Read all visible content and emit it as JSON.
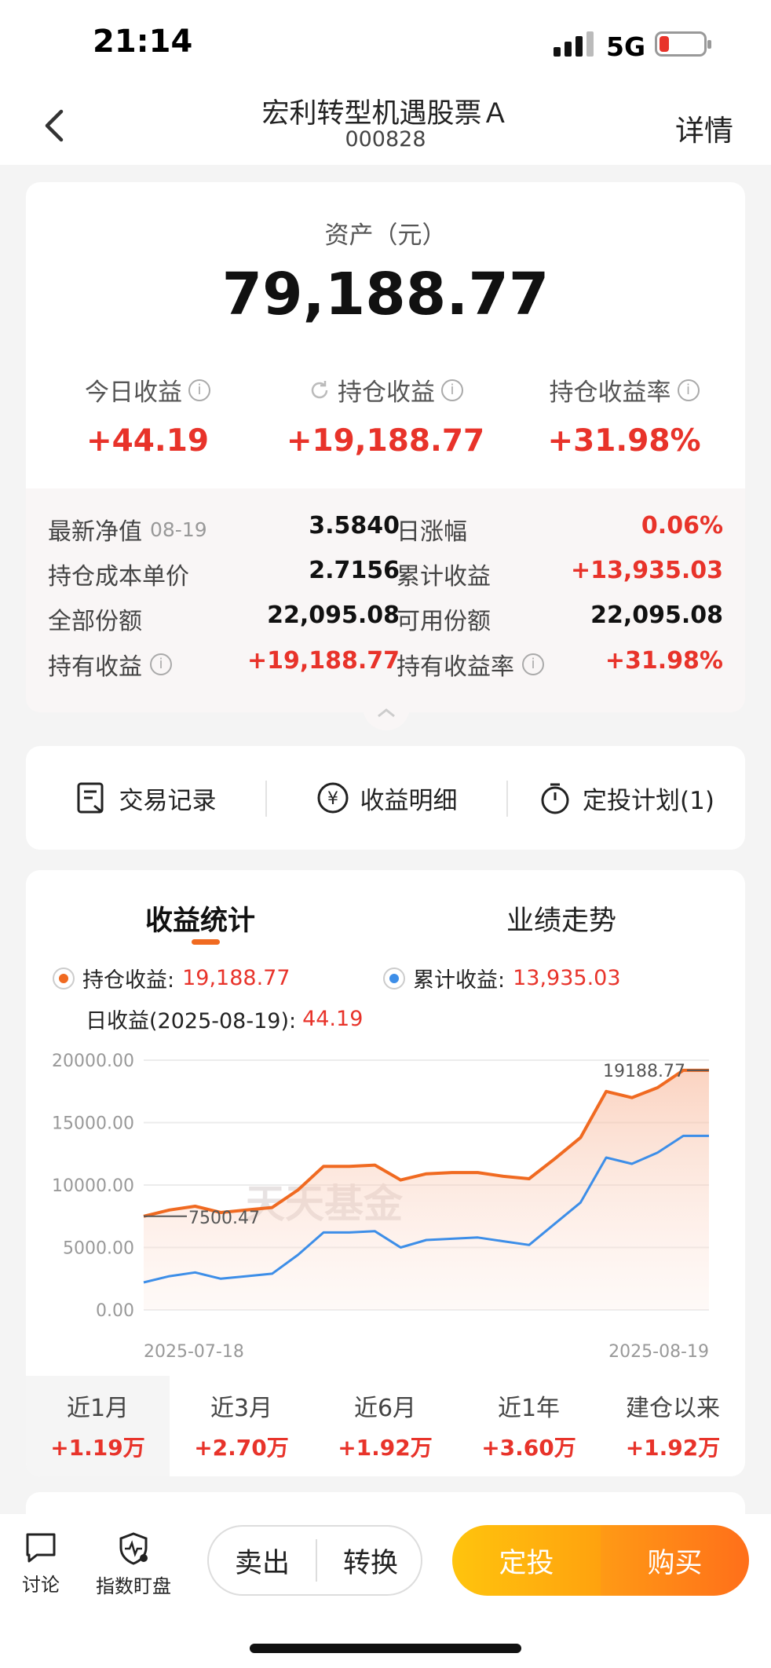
{
  "status_bar": {
    "time": "21:14",
    "network": "5G"
  },
  "nav": {
    "title": "宏利转型机遇股票Ａ",
    "code": "000828",
    "detail": "详情"
  },
  "asset": {
    "label": "资产（元）",
    "value": "79,188.77",
    "metrics": [
      {
        "label": "今日收益",
        "value": "+44.19"
      },
      {
        "label": "持仓收益",
        "value": "+19,188.77"
      },
      {
        "label": "持仓收益率",
        "value": "+31.98%"
      }
    ]
  },
  "details": {
    "nav_label": "最新净值",
    "nav_date": "08-19",
    "nav_value": "3.5840",
    "daily_change_label": "日涨幅",
    "daily_change_value": "0.06%",
    "cost_label": "持仓成本单价",
    "cost_value": "2.7156",
    "cum_label": "累计收益",
    "cum_value": "+13,935.03",
    "shares_label": "全部份额",
    "shares_value": "22,095.08",
    "avail_label": "可用份额",
    "avail_value": "22,095.08",
    "hold_label": "持有收益",
    "hold_value": "+19,188.77",
    "hold_rate_label": "持有收益率",
    "hold_rate_value": "+31.98%"
  },
  "actions": [
    {
      "label": "交易记录",
      "icon": "receipt-icon"
    },
    {
      "label": "收益明细",
      "icon": "yen-icon"
    },
    {
      "label": "定投计划(1)",
      "icon": "timer-icon"
    }
  ],
  "chart_tabs": {
    "active": "收益统计",
    "inactive": "业绩走势"
  },
  "legend": {
    "hold_label": "持仓收益:",
    "hold_value": "19,188.77",
    "cum_label": "累计收益:",
    "cum_value": "13,935.03",
    "daily_label": "日收益(2025-08-19):",
    "daily_value": "44.19"
  },
  "colors": {
    "accent_red": "#e8332a",
    "hold_series": "#f06a21",
    "cum_series": "#3d8ee8",
    "buy_start": "#ffc40d",
    "buy_end": "#ff7a1a"
  },
  "watermark": "天天基金",
  "chart_data": {
    "type": "area",
    "x_start": "2025-07-18",
    "x_end": "2025-08-19",
    "ylim": [
      0,
      20000
    ],
    "yticks": [
      "20000.00",
      "15000.00",
      "10000.00",
      "5000.00",
      "0.00"
    ],
    "series": [
      {
        "values": [
          7500,
          8000,
          8300,
          7800,
          8000,
          8200,
          9600,
          11500,
          11500,
          11600,
          10400,
          10900,
          11000,
          11000,
          10700,
          10500,
          12100,
          13800,
          17500,
          17000,
          17800,
          19188.77,
          19188.77
        ]
      },
      {
        "values": [
          2200,
          2700,
          3000,
          2500,
          2700,
          2900,
          4400,
          6200,
          6200,
          6300,
          5000,
          5600,
          5700,
          5800,
          5500,
          5200,
          6900,
          8600,
          12200,
          11700,
          12600,
          13935,
          13935
        ]
      }
    ],
    "annotations": [
      {
        "label": "7500.47"
      },
      {
        "label": "19188.77"
      }
    ]
  },
  "periods": [
    {
      "label": "近1月",
      "value": "+1.19万"
    },
    {
      "label": "近3月",
      "value": "+2.70万"
    },
    {
      "label": "近6月",
      "value": "+1.92万"
    },
    {
      "label": "近1年",
      "value": "+3.60万"
    },
    {
      "label": "建仓以来",
      "value": "+1.92万"
    }
  ],
  "bottom_bar": {
    "discuss": "讨论",
    "index_watch": "指数盯盘",
    "sell": "卖出",
    "convert": "转换",
    "auto_invest": "定投",
    "buy": "购买"
  }
}
